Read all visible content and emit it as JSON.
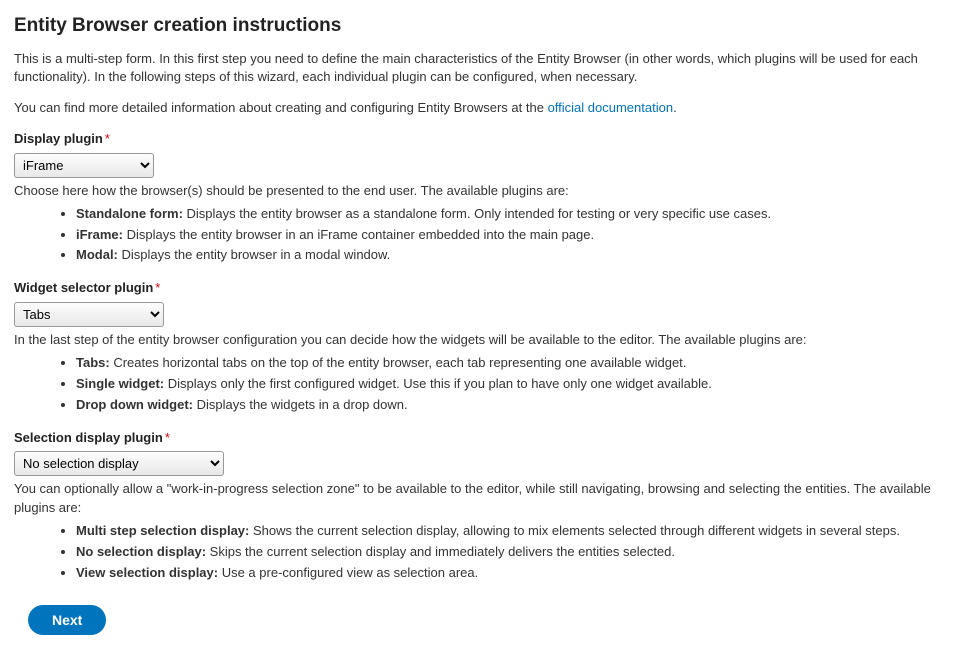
{
  "title": "Entity Browser creation instructions",
  "intro1": "This is a multi-step form. In this first step you need to define the main characteristics of the Entity Browser (in other words, which plugins will be used for each functionality). In the following steps of this wizard, each individual plugin can be configured, when necessary.",
  "intro2_prefix": "You can find more detailed information about creating and configuring Entity Browsers at the ",
  "intro2_link": "official documentation",
  "intro2_suffix": ".",
  "sections": {
    "display": {
      "label": "Display plugin",
      "selected": "iFrame",
      "help": "Choose here how the browser(s) should be presented to the end user. The available plugins are:",
      "options": [
        {
          "name": "Standalone form:",
          "desc": " Displays the entity browser as a standalone form. Only intended for testing or very specific use cases."
        },
        {
          "name": "iFrame:",
          "desc": " Displays the entity browser in an iFrame container embedded into the main page."
        },
        {
          "name": "Modal:",
          "desc": " Displays the entity browser in a modal window."
        }
      ]
    },
    "widget": {
      "label": "Widget selector plugin",
      "selected": "Tabs",
      "help": "In the last step of the entity browser configuration you can decide how the widgets will be available to the editor. The available plugins are:",
      "options": [
        {
          "name": "Tabs:",
          "desc": " Creates horizontal tabs on the top of the entity browser, each tab representing one available widget."
        },
        {
          "name": "Single widget:",
          "desc": " Displays only the first configured widget. Use this if you plan to have only one widget available."
        },
        {
          "name": "Drop down widget:",
          "desc": " Displays the widgets in a drop down."
        }
      ]
    },
    "selection": {
      "label": "Selection display plugin",
      "selected": "No selection display",
      "help": "You can optionally allow a \"work-in-progress selection zone\" to be available to the editor, while still navigating, browsing and selecting the entities. The available plugins are:",
      "options": [
        {
          "name": "Multi step selection display:",
          "desc": " Shows the current selection display, allowing to mix elements selected through different widgets in several steps."
        },
        {
          "name": "No selection display:",
          "desc": " Skips the current selection display and immediately delivers the entities selected."
        },
        {
          "name": "View selection display:",
          "desc": " Use a pre-configured view as selection area."
        }
      ]
    }
  },
  "next_button": "Next"
}
